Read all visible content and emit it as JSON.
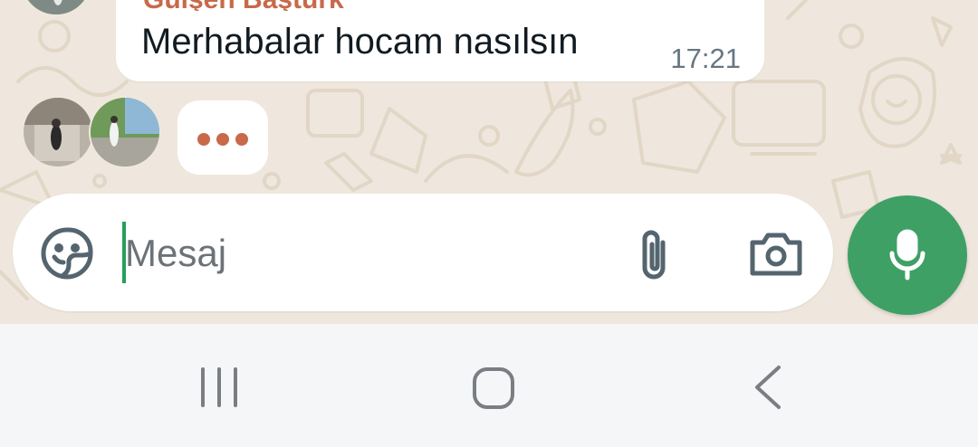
{
  "chat": {
    "message": {
      "sender": "Gülşen Baştürk",
      "text": "Merhabalar hocam nasılsın",
      "time": "17:21"
    },
    "typing_indicator": {
      "participants": [
        "participant-1",
        "participant-2"
      ]
    }
  },
  "composer": {
    "placeholder": "Mesaj",
    "value": "",
    "emoji_icon": "sticker-smiley-icon",
    "attach_icon": "paperclip-icon",
    "camera_icon": "camera-icon",
    "mic_icon": "microphone-icon"
  },
  "navbar": {
    "recent_icon": "recent-apps-icon",
    "home_icon": "home-icon",
    "back_icon": "back-icon"
  },
  "colors": {
    "accent_green": "#3ea065",
    "sender_name": "#c8694a",
    "typing_dots": "#c8694a",
    "wallpaper": "#efe7dd"
  }
}
